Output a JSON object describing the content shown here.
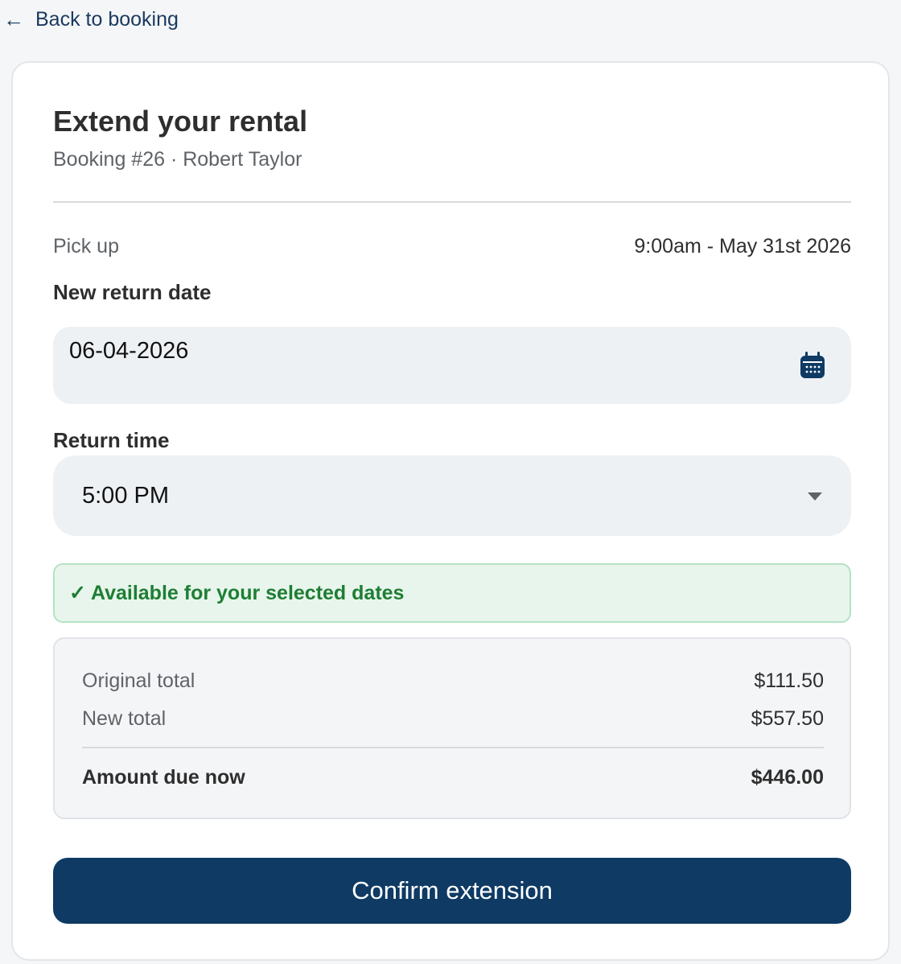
{
  "nav": {
    "back_icon": "arrow-left-icon",
    "back_label": "Back to booking"
  },
  "card": {
    "title": "Extend your rental",
    "subtitle": "Booking #26 · Robert Taylor"
  },
  "pickup": {
    "label": "Pick up",
    "value": "9:00am - May 31st 2026"
  },
  "return_date": {
    "label": "New return date",
    "value": "06-04-2026",
    "icon": "calendar-icon"
  },
  "return_time": {
    "label": "Return time",
    "selected": "5:00 PM",
    "icon": "chevron-down-icon"
  },
  "availability": {
    "icon": "check-icon",
    "check_glyph": "✓",
    "text": "Available for your selected dates"
  },
  "summary": {
    "original_total_label": "Original total",
    "original_total_value": "$111.50",
    "new_total_label": "New total",
    "new_total_value": "$557.50",
    "amount_due_label": "Amount due now",
    "amount_due_value": "$446.00"
  },
  "actions": {
    "confirm_label": "Confirm extension"
  },
  "colors": {
    "primary": "#0e3a64",
    "link": "#1b3a5e",
    "success_text": "#1e7e34",
    "success_bg": "#e8f5ec",
    "success_border": "#b5e2c3",
    "field_bg": "#eef1f4",
    "page_bg": "#f4f6f8"
  }
}
